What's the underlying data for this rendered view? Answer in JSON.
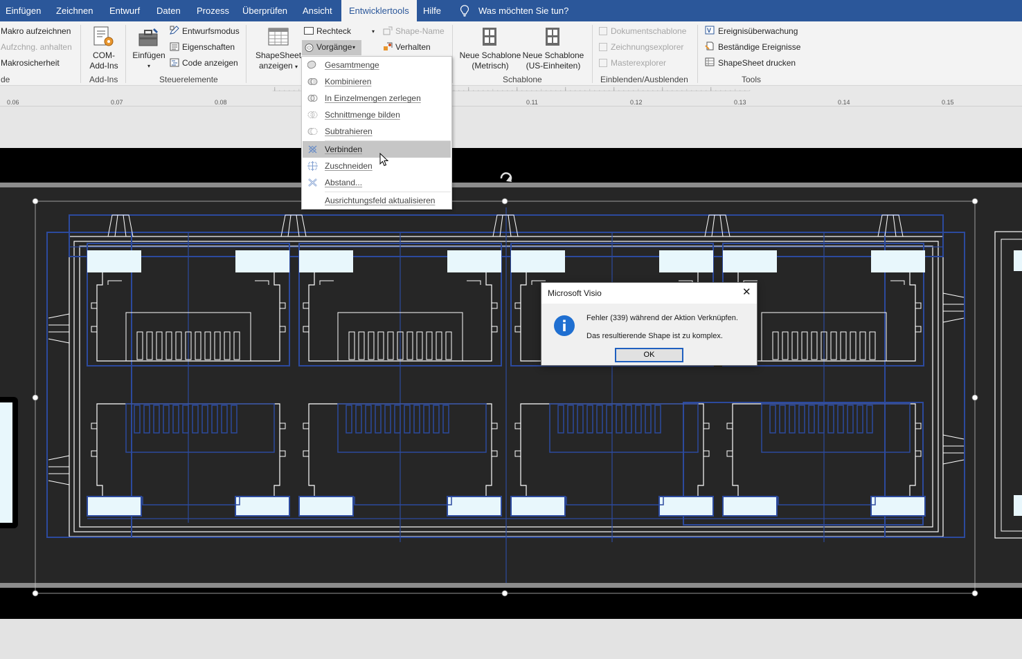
{
  "tabs": [
    "Einfügen",
    "Zeichnen",
    "Entwurf",
    "Daten",
    "Prozess",
    "Überprüfen",
    "Ansicht",
    "Entwicklertools",
    "Hilfe"
  ],
  "tab_active": "Entwicklertools",
  "tell_me": "Was möchten Sie tun?",
  "ribbon": {
    "code": {
      "record_macro": "Makro aufzeichnen",
      "pause_recording": "Aufzchng. anhalten",
      "macro_security": "Makrosicherheit",
      "group_label": "de"
    },
    "addins": {
      "com_line1": "COM-",
      "com_line2": "Add-Ins",
      "group_label": "Add-Ins"
    },
    "controls": {
      "insert": "Einfügen",
      "design_mode": "Entwurfsmodus",
      "properties": "Eigenschaften",
      "view_code": "Code anzeigen",
      "group_label": "Steuerelemente"
    },
    "shape_design": {
      "shapesheet_line1": "ShapeSheet",
      "shapesheet_line2": "anzeigen",
      "rectangle": "Rechteck",
      "operations": "Vorgänge",
      "shape_name": "Shape-Name",
      "behavior": "Verhalten"
    },
    "stencil": {
      "new_metric_line1": "Neue Schablone",
      "new_metric_line2": "(Metrisch)",
      "new_us_line1": "Neue Schablone",
      "new_us_line2": "(US-Einheiten)",
      "group_label": "Schablone"
    },
    "show_hide": {
      "document_stencil": "Dokumentschablone",
      "drawing_explorer": "Zeichnungsexplorer",
      "master_explorer": "Masterexplorer",
      "group_label": "Einblenden/Ausblenden"
    },
    "tools": {
      "event_monitor": "Ereignisüberwachung",
      "persistent_events": "Beständige Ereignisse",
      "print_shapesheet": "ShapeSheet drucken",
      "group_label": "Tools"
    }
  },
  "ruler_ticks": [
    "0.06",
    "0.07",
    "0.08",
    "0.11",
    "0.12",
    "0.13",
    "0.14",
    "0.15"
  ],
  "operations_menu": {
    "items": [
      {
        "label": "Gesamtmenge",
        "icon": "union-icon"
      },
      {
        "label": "Kombinieren",
        "icon": "combine-icon"
      },
      {
        "label": "In Einzelmengen zerlegen",
        "icon": "fragment-icon"
      },
      {
        "label": "Schnittmenge bilden",
        "icon": "intersect-icon"
      },
      {
        "label": "Subtrahieren",
        "icon": "subtract-icon"
      },
      {
        "label": "Verbinden",
        "icon": "join-icon"
      },
      {
        "label": "Zuschneiden",
        "icon": "trim-icon"
      },
      {
        "label": "Abstand...",
        "icon": "offset-icon"
      },
      {
        "label": "Ausrichtungsfeld aktualisieren",
        "icon": ""
      }
    ],
    "highlighted": "Verbinden"
  },
  "dialog": {
    "title": "Microsoft Visio",
    "close_glyph": "✕",
    "message_line1": "Fehler (339) während der Aktion Verknüpfen.",
    "message_line2": "Das resultierende Shape ist zu komplex.",
    "ok_label": "OK"
  },
  "colors": {
    "accent": "#2b579a",
    "drawing_blue": "#2c4a9e",
    "port_fill": "#e8f7fc",
    "dialog_info": "#1f6fd1"
  }
}
